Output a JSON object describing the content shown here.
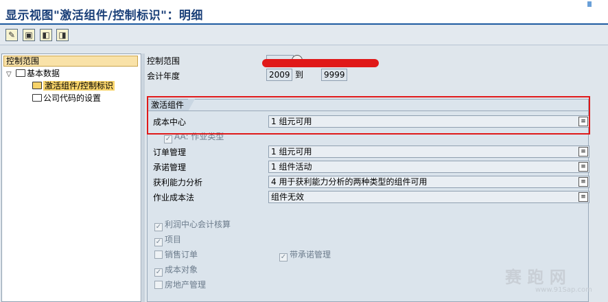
{
  "window": {
    "title": "显示视图\"激活组件/控制标识\"：明细"
  },
  "toolbar": {
    "buttons": [
      {
        "name": "edit-icon",
        "glyph": "✎"
      },
      {
        "name": "other-entry-icon",
        "glyph": "▣"
      },
      {
        "name": "previous-entry-icon",
        "glyph": "◧"
      },
      {
        "name": "next-entry-icon",
        "glyph": "◨"
      }
    ]
  },
  "tree": {
    "header": "控制范围",
    "items": [
      {
        "label": "基本数据",
        "toggle": "▽"
      },
      {
        "label": "激活组件/控制标识"
      },
      {
        "label": "公司代码的设置"
      }
    ]
  },
  "header": {
    "controlling_area_label": "控制范围",
    "controlling_area_value": "",
    "fiscal_year_label": "会计年度",
    "year_from": "2009",
    "to_label": "到",
    "year_to": "9999"
  },
  "group": {
    "title": "激活组件",
    "rows": [
      {
        "label": "成本中心",
        "value": "1 组元可用"
      },
      {
        "label": "订单管理",
        "value": "1 组元可用"
      },
      {
        "label": "承诺管理",
        "value": "1 组件活动"
      },
      {
        "label": "获利能力分析",
        "value": "4 用于获利能力分析的两种类型的组件可用"
      },
      {
        "label": "作业成本法",
        "value": "组件无效"
      }
    ],
    "aa_label": "AA: 作业类型",
    "checkboxes": {
      "profit_center": "利润中心会计核算",
      "projects": "项目",
      "sales_orders": "销售订单",
      "commitment_mgmt": "带承诺管理",
      "cost_objects": "成本对象",
      "real_estate": "房地产管理"
    }
  },
  "watermark": {
    "text": "赛 跑 网",
    "url": "www.91Sap.com"
  }
}
